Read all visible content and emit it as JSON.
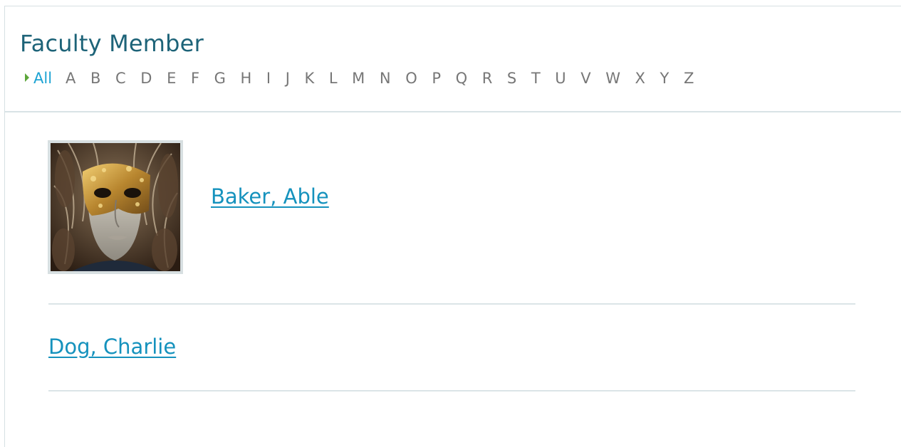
{
  "page": {
    "title": "Faculty Member"
  },
  "alphabet": {
    "all_label": "All",
    "letters": [
      "A",
      "B",
      "C",
      "D",
      "E",
      "F",
      "G",
      "H",
      "I",
      "J",
      "K",
      "L",
      "M",
      "N",
      "O",
      "P",
      "Q",
      "R",
      "S",
      "T",
      "U",
      "V",
      "W",
      "X",
      "Y",
      "Z"
    ]
  },
  "faculty": [
    {
      "name": "Baker, Able",
      "has_photo": true,
      "photo_subject": "masquerade-mask-portrait"
    },
    {
      "name": "Dog, Charlie",
      "has_photo": false
    }
  ],
  "colors": {
    "title": "#1d6378",
    "active_filter": "#1ca3d3",
    "link": "#1592bd",
    "arrow": "#5ca63a",
    "divider": "#d9e3e6"
  }
}
